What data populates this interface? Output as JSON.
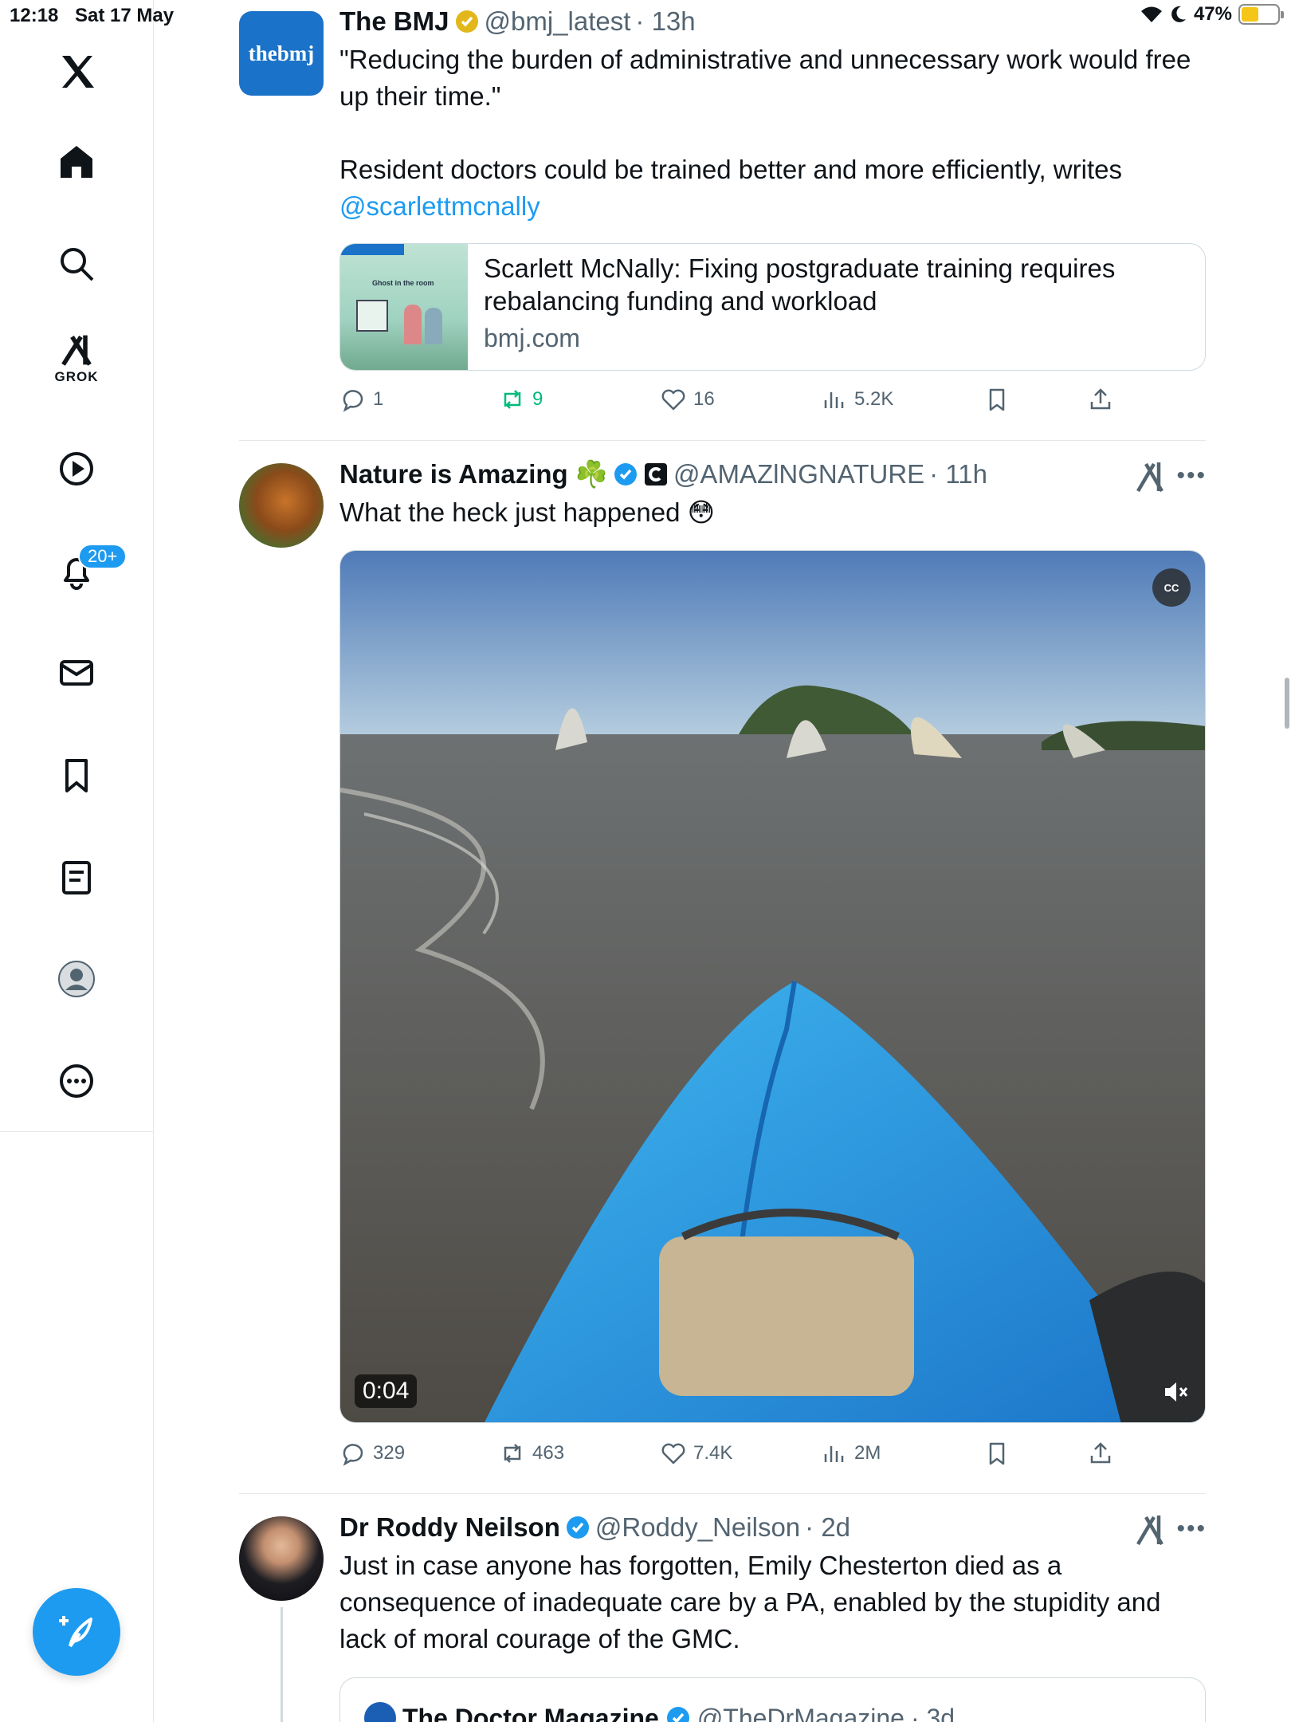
{
  "status_bar": {
    "time": "12:18",
    "date": "Sat 17 May",
    "battery": "47%",
    "battery_level": 0.47
  },
  "sidebar": {
    "items": [
      {
        "name": "x-logo",
        "label": ""
      },
      {
        "name": "home",
        "label": ""
      },
      {
        "name": "search",
        "label": ""
      },
      {
        "name": "grok",
        "label": "GROK"
      },
      {
        "name": "video",
        "label": ""
      },
      {
        "name": "notifications",
        "label": "",
        "badge": "20+"
      },
      {
        "name": "messages",
        "label": ""
      },
      {
        "name": "bookmarks",
        "label": ""
      },
      {
        "name": "lists",
        "label": ""
      },
      {
        "name": "profile",
        "label": ""
      },
      {
        "name": "more",
        "label": ""
      }
    ]
  },
  "tweets": [
    {
      "display_name": "The BMJ",
      "handle": "@bmj_latest",
      "time": "· 13h",
      "avatar_text": "thebmj",
      "text_lines": [
        "\"Reducing the burden of administrative and unnecessary work would free up their time.\"",
        "Resident doctors could be trained better and more efficiently, writes"
      ],
      "mention": "@scarlettmcnally",
      "link_card": {
        "title": "Scarlett McNally: Fixing postgraduate training requires rebalancing funding and workload",
        "domain": "bmj.com",
        "thumb_text": "Ghost in the room"
      },
      "actions": {
        "replies": "1",
        "retweets": "9",
        "likes": "16",
        "views": "5.2K"
      }
    },
    {
      "display_name": "Nature is Amazing ☘️",
      "handle": "@AMAZlNGNATURE",
      "time": "· 11h",
      "text": "What the heck just happened 😳",
      "video": {
        "cc": "CC",
        "duration": "0:04"
      },
      "actions": {
        "replies": "329",
        "retweets": "463",
        "likes": "7.4K",
        "views": "2M"
      }
    },
    {
      "display_name": "Dr Roddy Neilson",
      "handle": "@Roddy_Neilson",
      "time": "· 2d",
      "text": "Just in case anyone has forgotten, Emily Chesterton died as a consequence of inadequate care by a PA, enabled by the stupidity and lack of moral courage of the GMC.",
      "quote": {
        "display_name": "The Doctor Magazine",
        "handle": "@TheDrMagazine",
        "time": "· 3d"
      }
    }
  ],
  "colors": {
    "accent": "#1d9bf0",
    "text": "#0f1419",
    "muted": "#536471",
    "retweet_active": "#00ba7c",
    "verified_gold": "#e2b719"
  }
}
